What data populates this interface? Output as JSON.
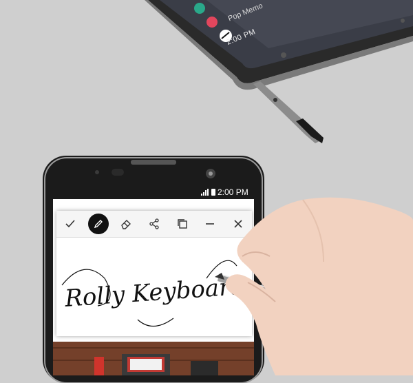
{
  "top_phone": {
    "status_time": "2:00 PM",
    "menu_item_label": "Pop Memo"
  },
  "phone": {
    "status_time": "2:00 PM"
  },
  "memo": {
    "handwriting": "Rolly Keyboard",
    "toolbar": {
      "icons": [
        "check-icon",
        "pen-icon",
        "eraser-icon",
        "share-icon",
        "copy-icon",
        "minimize-icon",
        "close-icon"
      ],
      "active_tool": "pen-icon"
    }
  },
  "colors": {
    "background": "#cfcfcf",
    "phone_body": "#1b1b1b",
    "toolbar": "#f5f5f5",
    "active_tool": "#111111",
    "ink": "#111111"
  }
}
